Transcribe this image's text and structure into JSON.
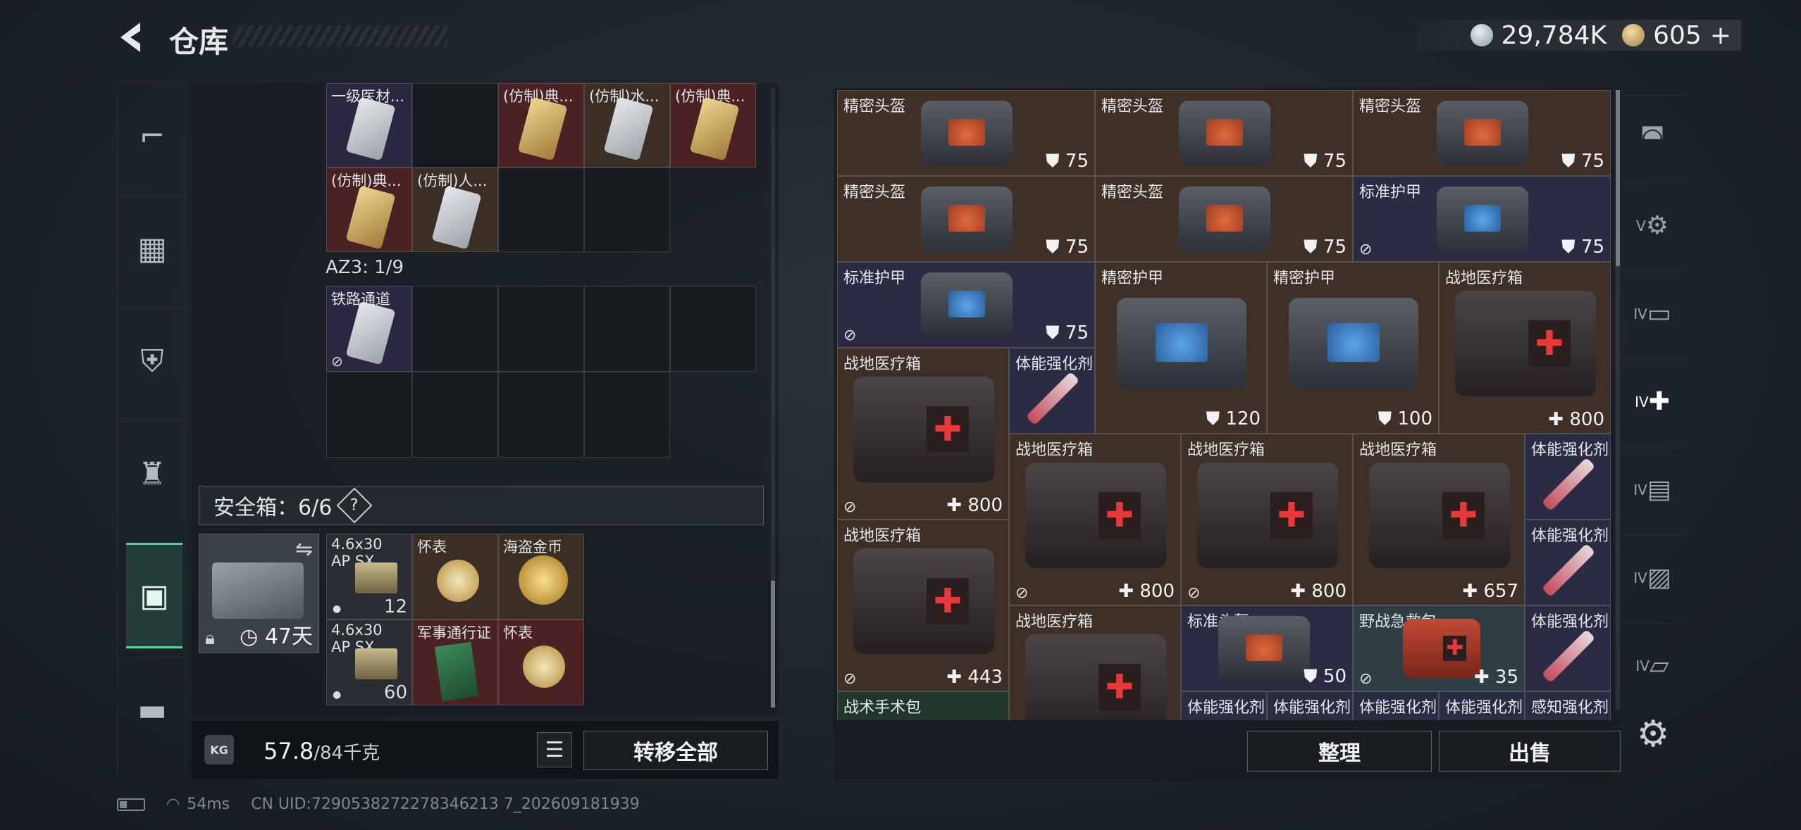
{
  "header": {
    "title": "仓库",
    "silver_amount": "29,784K",
    "gold_amount": "605",
    "gold_plus": "+"
  },
  "left_rail": {
    "icons": [
      "pistol-icon",
      "armor-icon",
      "backpack-icon",
      "bag-icon",
      "locker-icon",
      "toolbox-icon"
    ]
  },
  "container_top": {
    "items": [
      {
        "label": "一级医材..."
      },
      {
        "label": "(仿制)典..."
      },
      {
        "label": "(仿制)水..."
      },
      {
        "label": "(仿制)典..."
      },
      {
        "label": "(仿制)典..."
      },
      {
        "label": "(仿制)人..."
      }
    ]
  },
  "az3": {
    "label": "AZ3: 1/9",
    "item_label": "铁路通道"
  },
  "safe_box": {
    "label": "安全箱：6/6",
    "help": "?",
    "days_left": "47天"
  },
  "safe_items": [
    {
      "label": "4.6x30",
      "sub": "AP SX",
      "count": "12"
    },
    {
      "label": "怀表"
    },
    {
      "label": "海盗金币"
    },
    {
      "label": "4.6x30",
      "sub": "AP SX",
      "count": "60"
    },
    {
      "label": "军事通行证"
    },
    {
      "label": "怀表"
    }
  ],
  "bottom": {
    "weight_icon": "KG",
    "weight_current": "57.8",
    "weight_max": "/84千克",
    "transfer_all": "转移全部"
  },
  "status": {
    "ping": "54ms",
    "uid": "CN UID:7290538272278346213 7_202609181939"
  },
  "stash": {
    "items": [
      {
        "label": "精密头盔",
        "value": "75"
      },
      {
        "label": "精密头盔",
        "value": "75"
      },
      {
        "label": "精密头盔",
        "value": "75"
      },
      {
        "label": "精密头盔",
        "value": "75"
      },
      {
        "label": "精密头盔",
        "value": "75"
      },
      {
        "label": "标准护甲",
        "value": "75"
      },
      {
        "label": "标准护甲",
        "value": "75"
      },
      {
        "label": "精密护甲",
        "value": "120"
      },
      {
        "label": "精密护甲",
        "value": "100"
      },
      {
        "label": "战地医疗箱",
        "value": "800"
      },
      {
        "label": "战地医疗箱",
        "value": "800"
      },
      {
        "label": "体能强化剂"
      },
      {
        "label": "战地医疗箱",
        "value": "800"
      },
      {
        "label": "战地医疗箱",
        "value": "800"
      },
      {
        "label": "战地医疗箱",
        "value": "657"
      },
      {
        "label": "体能强化剂"
      },
      {
        "label": "战地医疗箱",
        "value": "443"
      },
      {
        "label": "体能强化剂"
      },
      {
        "label": "战地医疗箱"
      },
      {
        "label": "标准头盔",
        "value": "50"
      },
      {
        "label": "野战急救包",
        "value": "35"
      },
      {
        "label": "体能强化剂"
      },
      {
        "label": "战术手术包"
      },
      {
        "label": "体能强化剂"
      },
      {
        "label": "体能强化剂"
      },
      {
        "label": "体能强化剂"
      },
      {
        "label": "体能强化剂"
      },
      {
        "label": "感知强化剂"
      }
    ]
  },
  "actions": {
    "sort": "整理",
    "sell": "出售"
  },
  "right_rail": {
    "labels": [
      "",
      "V",
      "IV",
      "IV",
      "IV",
      "IV",
      "IV"
    ]
  }
}
